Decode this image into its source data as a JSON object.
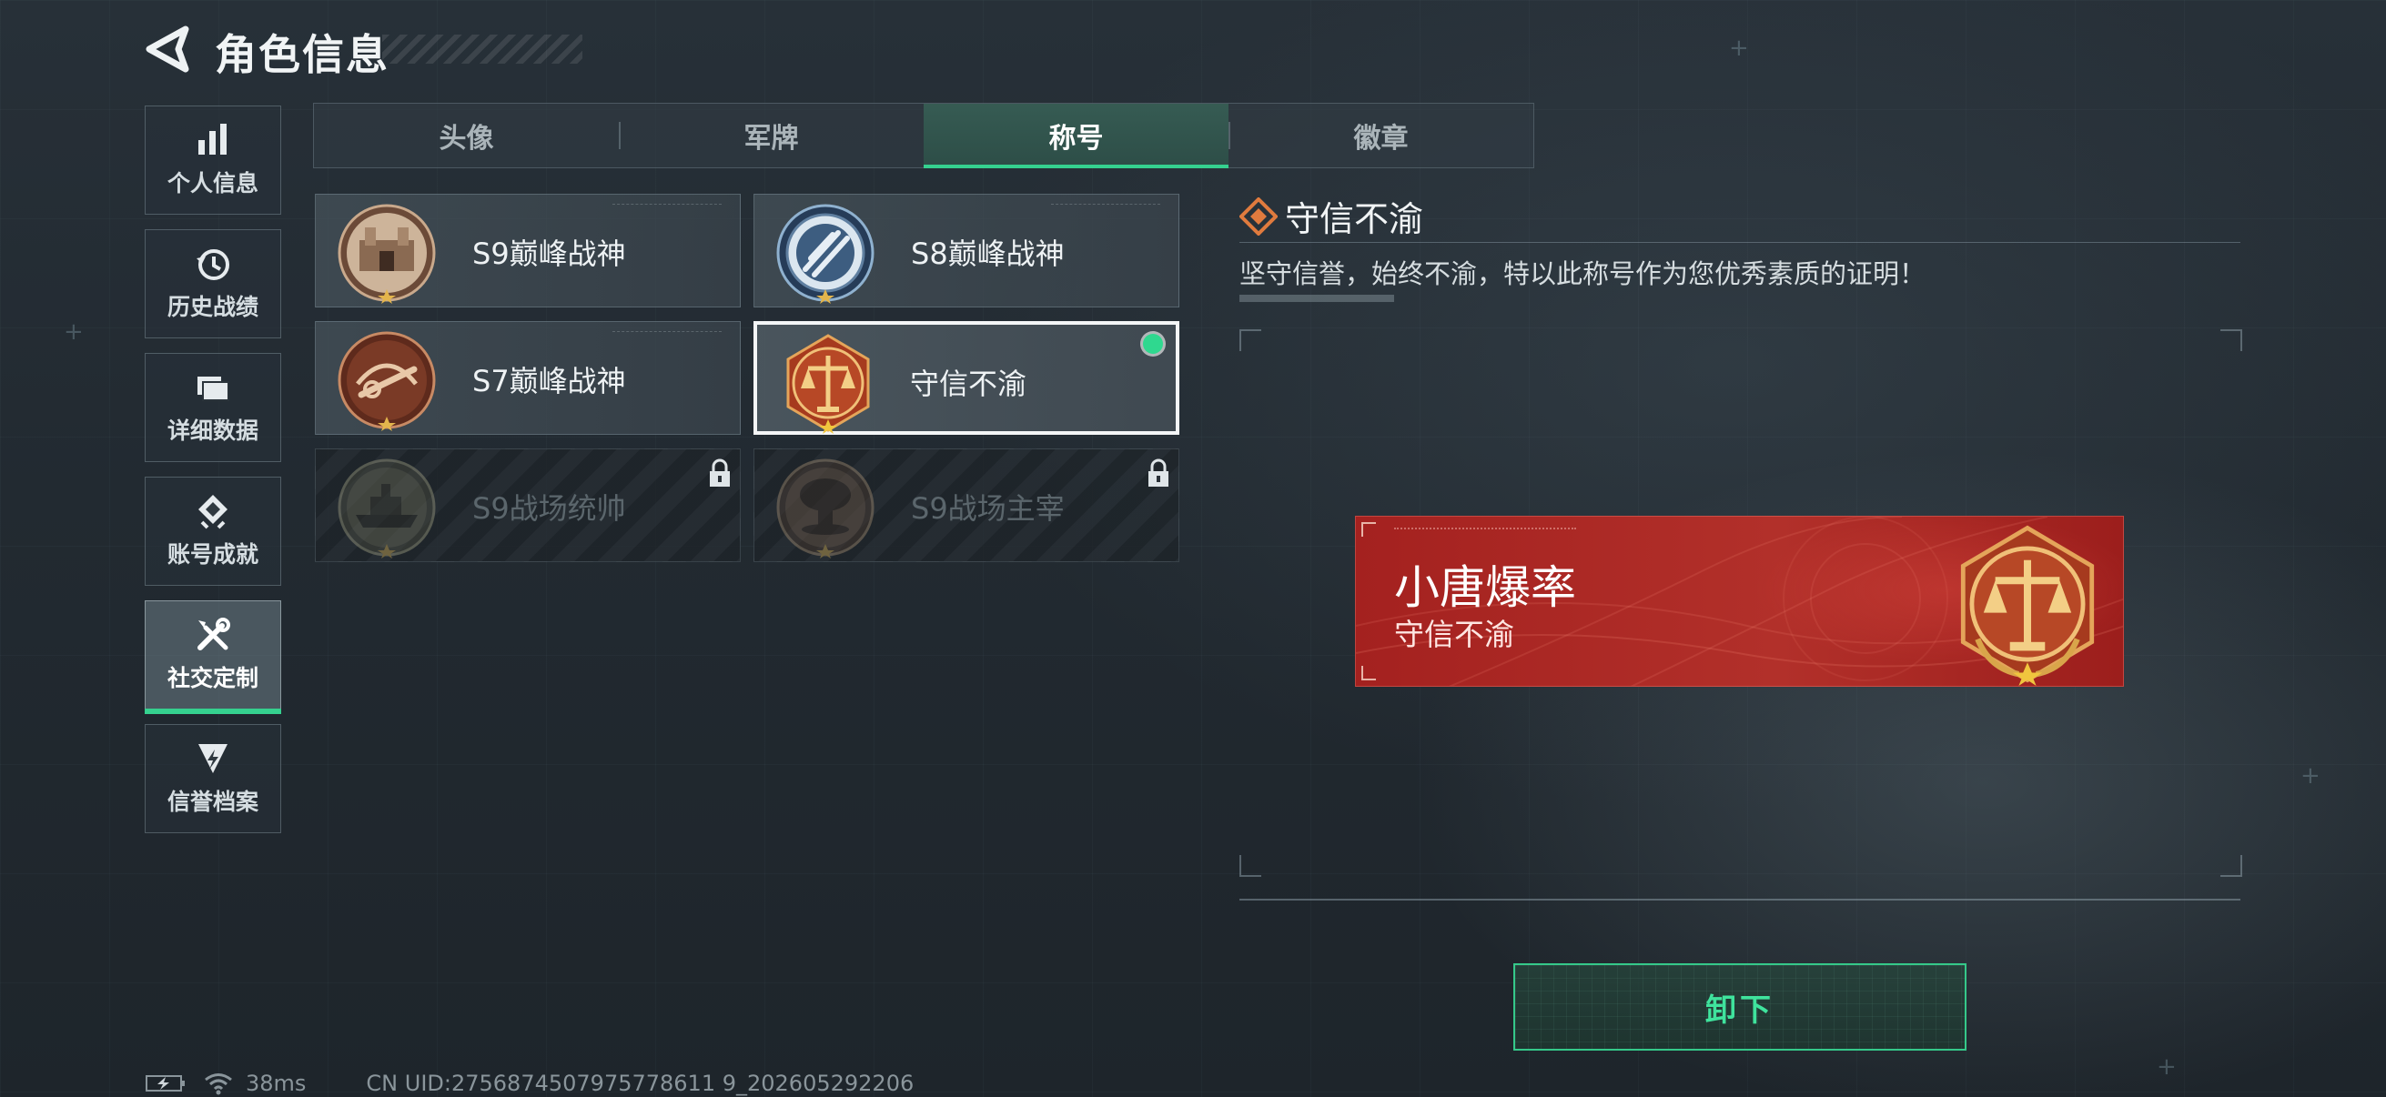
{
  "header": {
    "title": "角色信息",
    "back_icon": "back-arrow-icon"
  },
  "sidebar": {
    "items": [
      {
        "label": "个人信息",
        "icon": "bar-chart-icon",
        "active": false
      },
      {
        "label": "历史战绩",
        "icon": "clock-history-icon",
        "active": false
      },
      {
        "label": "详细数据",
        "icon": "folder-icon",
        "active": false
      },
      {
        "label": "账号成就",
        "icon": "achievement-icon",
        "active": false
      },
      {
        "label": "社交定制",
        "icon": "tools-icon",
        "active": true
      },
      {
        "label": "信誉档案",
        "icon": "credit-badge-icon",
        "active": false
      }
    ]
  },
  "tabs": [
    {
      "label": "头像",
      "active": false
    },
    {
      "label": "军牌",
      "active": false
    },
    {
      "label": "称号",
      "active": true
    },
    {
      "label": "徽章",
      "active": false
    }
  ],
  "titles": [
    {
      "name": "S9巅峰战神",
      "icon": "fortress-medal-icon",
      "state": "owned"
    },
    {
      "name": "S8巅峰战神",
      "icon": "blue-emblem-medal-icon",
      "state": "owned"
    },
    {
      "name": "S7巅峰战神",
      "icon": "crossbow-medal-icon",
      "state": "owned"
    },
    {
      "name": "守信不渝",
      "icon": "scales-medal-icon",
      "state": "equipped"
    },
    {
      "name": "S9战场统帅",
      "icon": "battleship-medal-icon",
      "state": "locked"
    },
    {
      "name": "S9战场主宰",
      "icon": "mushroom-cloud-medal-icon",
      "state": "locked"
    }
  ],
  "detail": {
    "title": "守信不渝",
    "description": "坚守信誉，始终不渝，特以此称号作为您优秀素质的证明！",
    "icon": "diamond-title-icon"
  },
  "preview": {
    "player_name": "小唐爆率",
    "title": "守信不渝"
  },
  "actions": {
    "unequip_label": "卸下"
  },
  "status_bar": {
    "ping": "38ms",
    "uid": "CN UID:2756874507975778611 9_202605292206"
  },
  "colors": {
    "accent_green": "#35d18f",
    "preview_red": "#a4211f",
    "medal_gold": "#d9a54a"
  }
}
